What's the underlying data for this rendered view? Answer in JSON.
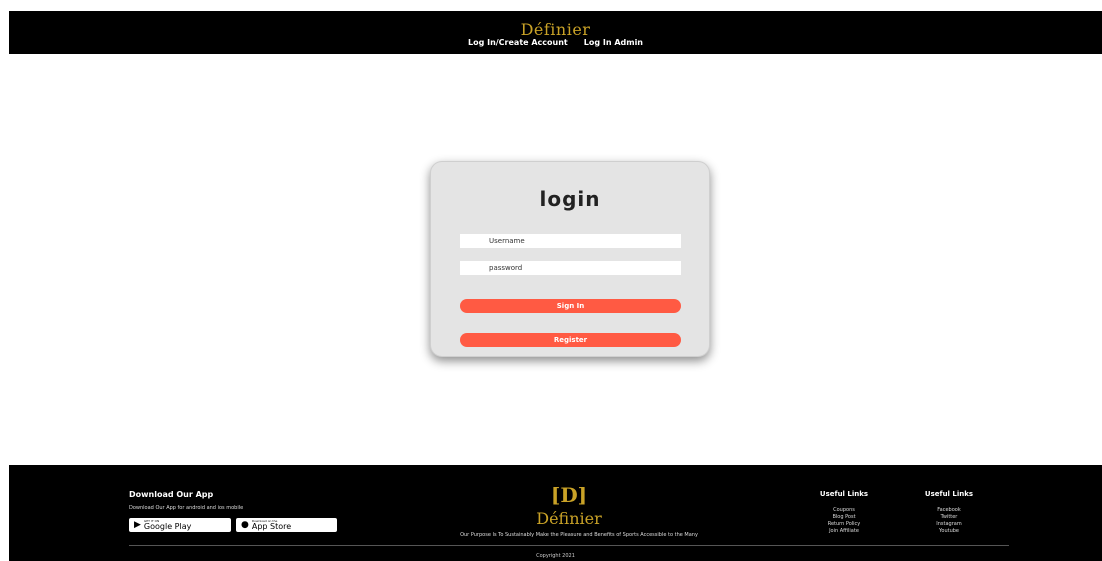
{
  "header": {
    "brand": "Définier",
    "nav": [
      "Log In/Create Account",
      "Log In Admin"
    ]
  },
  "login": {
    "title": "login",
    "username_placeholder": "Username",
    "password_placeholder": "password",
    "signin_label": "Sign In",
    "register_label": "Register"
  },
  "footer": {
    "download_title": "Download Our App",
    "download_sub": "Download Our App for android and ios mobile",
    "google_play_small": "GET IT ON",
    "google_play_label": "Google Play",
    "app_store_small": "Download on the",
    "app_store_label": "App Store",
    "logo_mark": "[D]",
    "logo_name": "Définier",
    "tagline": "Our Purpose Is To Sustainably Make the Pleasure and Benefits of Sports Accessible to the Many",
    "useful_links_1": {
      "title": "Useful Links",
      "items": [
        "Coupons",
        "Blog Post",
        "Return Policy",
        "Join Affiliate"
      ]
    },
    "useful_links_2": {
      "title": "Useful Links",
      "items": [
        "Facebook",
        "Twitter",
        "Instagram",
        "Youtube"
      ]
    },
    "copyright": "Copyright 2021"
  },
  "colors": {
    "accent": "#ff5a43",
    "brand_gold": "#c9a227",
    "header_bg": "#000000",
    "card_bg": "#e4e4e4"
  }
}
